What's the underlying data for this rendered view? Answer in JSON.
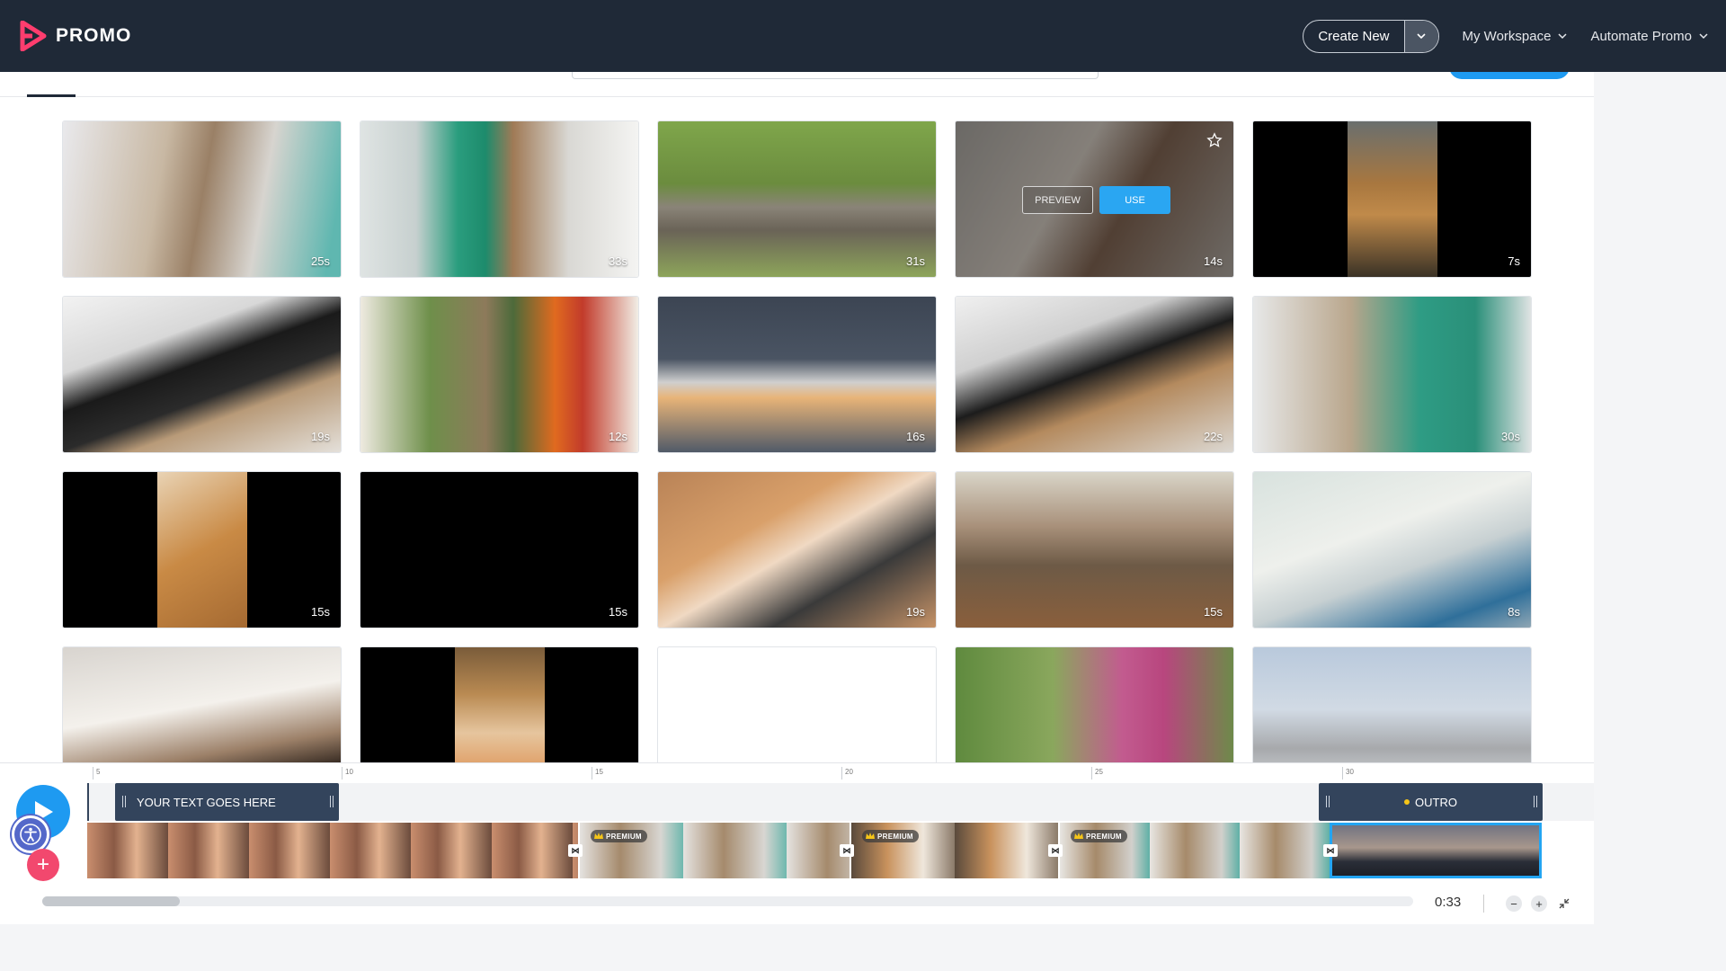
{
  "app": {
    "logo_text": "PROMO",
    "create_new_label": "Create New",
    "nav": [
      {
        "label": "My Workspace"
      },
      {
        "label": "Automate Promo"
      }
    ]
  },
  "colors": {
    "topbar": "#1f2937",
    "accent": "#1e9af1",
    "add": "#f2486e",
    "clip": "#33445c"
  },
  "grid": {
    "items": [
      {
        "duration": "25s",
        "theme": "woman-holding-fluffy-cat"
      },
      {
        "duration": "33s",
        "theme": "vet-with-cat"
      },
      {
        "duration": "31s",
        "theme": "two-cats-on-grass"
      },
      {
        "duration": "14s",
        "theme": "woman-with-cat-hovered",
        "hovered": true
      },
      {
        "duration": "7s",
        "theme": "tabby-looking-up-vertical"
      },
      {
        "duration": "19s",
        "theme": "black-cat-on-porch"
      },
      {
        "duration": "12s",
        "theme": "woman-holding-cat-indoors"
      },
      {
        "duration": "16s",
        "theme": "cat-with-laptop"
      },
      {
        "duration": "22s",
        "theme": "black-cats-on-porch"
      },
      {
        "duration": "30s",
        "theme": "vet-petting-cat"
      },
      {
        "duration": "15s",
        "theme": "ginger-cat-on-floor-vertical"
      },
      {
        "duration": "15s",
        "theme": "black-frame"
      },
      {
        "duration": "19s",
        "theme": "cat-on-desk-keyboard"
      },
      {
        "duration": "15s",
        "theme": "tabby-outdoors"
      },
      {
        "duration": "8s",
        "theme": "white-persian-cats"
      },
      {
        "duration": "",
        "theme": "puppy-and-kitten"
      },
      {
        "duration": "",
        "theme": "ginger-cat-christmas-vertical"
      },
      {
        "duration": "",
        "theme": "kittens-white-bg"
      },
      {
        "duration": "",
        "theme": "woman-with-cat-garden"
      },
      {
        "duration": "",
        "theme": "grey-kitten-sleeping"
      }
    ],
    "hover_actions": {
      "preview": "PREVIEW",
      "use": "USE"
    }
  },
  "timeline": {
    "ruler_labels": [
      "5",
      "10",
      "15",
      "20",
      "25",
      "30"
    ],
    "text_clip": "YOUR TEXT GOES HERE",
    "outro_clip": "OUTRO",
    "premium_label": "PREMIUM",
    "time": "0:33",
    "scroll_fraction": 0.1
  }
}
